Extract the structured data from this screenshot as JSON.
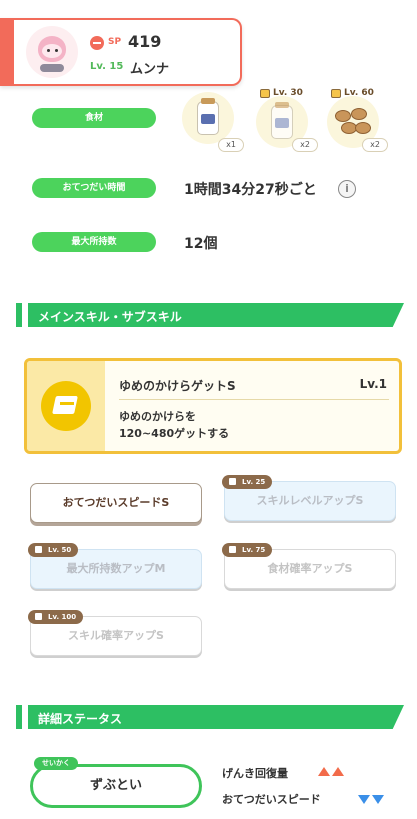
{
  "header": {
    "sp_label": "SP",
    "sp_value": "419",
    "level": "Lv. 15",
    "name": "ムンナ"
  },
  "rows": {
    "ingredients_label": "食材",
    "help_time_label": "おてつだい時間",
    "help_time_value": "1時間34分27秒ごと",
    "max_carry_label": "最大所持数",
    "max_carry_value": "12個"
  },
  "ingredients": [
    {
      "name": "milk-bottle",
      "qty": "x1"
    },
    {
      "name": "milk-bottle",
      "unlock": "Lv. 30",
      "qty": "x2"
    },
    {
      "name": "nuts",
      "unlock": "Lv. 60",
      "qty": "x2"
    }
  ],
  "sections": {
    "skills": "メインスキル・サブスキル",
    "status": "詳細ステータス"
  },
  "main_skill": {
    "name": "ゆめのかけらゲットS",
    "level": "Lv.1",
    "desc_line1": "ゆめのかけらを",
    "desc_line2": "120~480ゲットする"
  },
  "sub_skills": [
    {
      "label": "おてつだいスピードS",
      "state": "active"
    },
    {
      "label": "スキルレベルアップS",
      "unlock": "Lv. 25",
      "state": "blue"
    },
    {
      "label": "最大所持数アップM",
      "unlock": "Lv. 50",
      "state": "blue"
    },
    {
      "label": "食材確率アップS",
      "unlock": "Lv. 75",
      "state": "locked"
    },
    {
      "label": "スキル確率アップS",
      "unlock": "Lv. 100",
      "state": "locked"
    }
  ],
  "nature": {
    "tag": "せいかく",
    "name": "ずぶとい",
    "up_label": "げんき回復量",
    "down_label": "おてつだいスピード"
  },
  "colors": {
    "accent_green": "#2dbf63",
    "sp_red": "#f26b5a",
    "skill_gold": "#f2c03a",
    "up": "#f26b4a",
    "down": "#3a8fe8"
  },
  "icons": [
    "sp-icon",
    "info-icon",
    "lock-icon",
    "main-skill-icon"
  ]
}
